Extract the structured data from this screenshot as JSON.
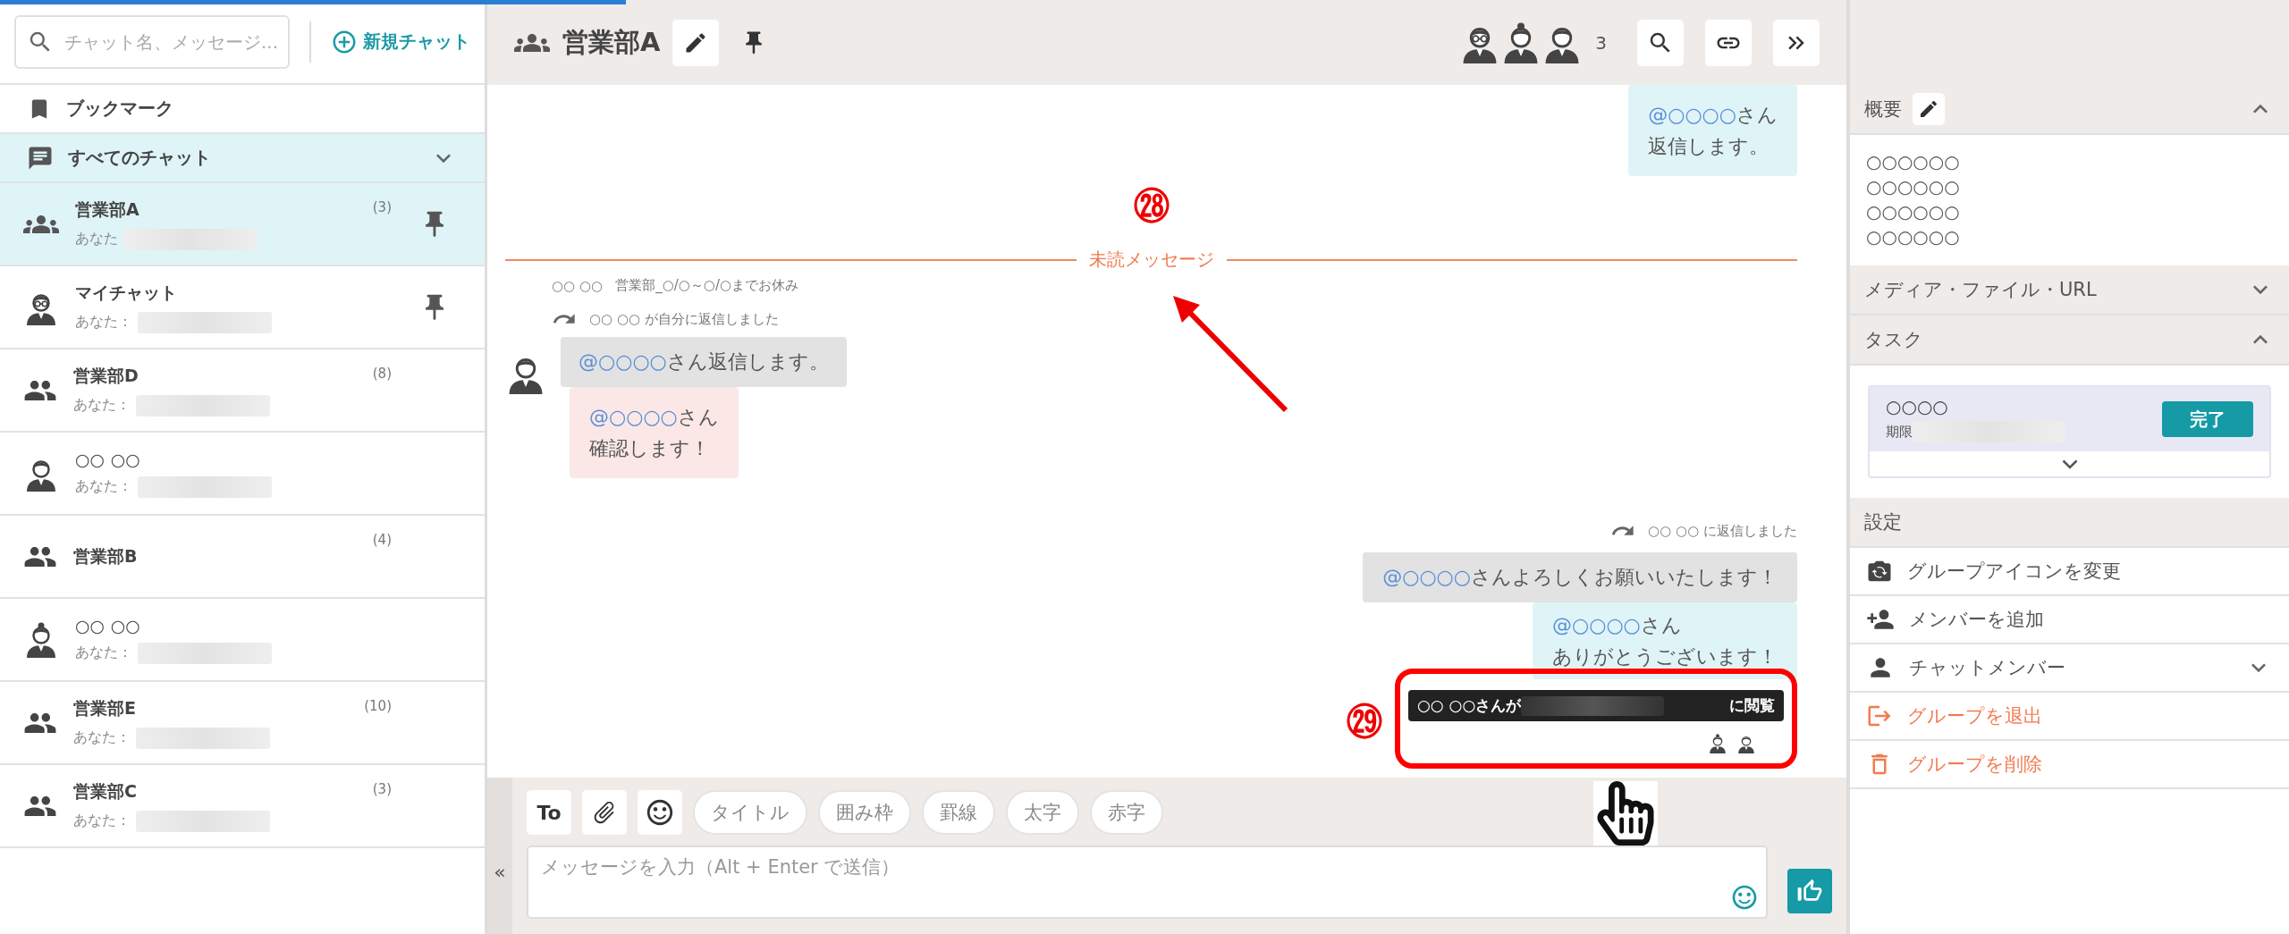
{
  "sidebar": {
    "search": {
      "placeholder": "チャット名、メッセージ..."
    },
    "new_chat": "新規チャット",
    "bookmark": "ブックマーク",
    "all_chats": {
      "label": "すべてのチャット",
      "expanded": true
    },
    "chats": [
      {
        "name": "営業部A",
        "preview": "あなた",
        "count": "(3)",
        "pinned": true,
        "selected": true,
        "kind": "groups"
      },
      {
        "name": "マイチャット",
        "preview": "あなた：",
        "pinned": true,
        "selected": false,
        "kind": "glasses"
      },
      {
        "name": "営業部D",
        "preview": "あなた：",
        "count": "(8)",
        "pinned": false,
        "selected": false,
        "kind": "group"
      },
      {
        "name": "○○ ○○",
        "preview": "あなた：",
        "pinned": false,
        "selected": false,
        "kind": "man"
      },
      {
        "name": "営業部B",
        "count": "(4)",
        "pinned": false,
        "selected": false,
        "kind": "group"
      },
      {
        "name": "○○ ○○",
        "preview": "あなた：",
        "pinned": false,
        "selected": false,
        "kind": "woman"
      },
      {
        "name": "営業部E",
        "preview": "あなた：",
        "count": "(10)",
        "pinned": false,
        "selected": false,
        "kind": "group"
      },
      {
        "name": "営業部C",
        "preview": "あなた：",
        "count": "(3)",
        "pinned": false,
        "selected": false,
        "kind": "group"
      }
    ]
  },
  "header": {
    "title": "営業部A",
    "member_count": "3"
  },
  "messages": [
    {
      "kind": "own",
      "lines": [
        {
          "mention": "@○○○○",
          "text": "さん"
        },
        {
          "text": "返信します。"
        }
      ]
    },
    {
      "kind": "divider",
      "label": "未読メッセージ",
      "marker": "㉘"
    },
    {
      "kind": "incoming",
      "sender": "○○ ○○",
      "status": "営業部_○/○～○/○までお休み",
      "reply_note": "○○ ○○ が自分に返信しました",
      "quote": {
        "mention": "@○○○○",
        "text": "さん返信します。"
      },
      "lines": [
        {
          "mention": "@○○○○",
          "text": "さん"
        },
        {
          "text": "確認します！"
        }
      ]
    },
    {
      "kind": "own",
      "reply_note": "○○ ○○ に返信しました",
      "quote": {
        "mention": "@○○○○",
        "text": "さんよろしくお願いいたします！"
      },
      "lines": [
        {
          "mention": "@○○○○",
          "text": "さん"
        },
        {
          "text": "ありがとうございます！"
        }
      ],
      "marker": "㉙",
      "tooltip": {
        "before": "○○ ○○さんが",
        "after": "に閲覧"
      },
      "readers": [
        {
          "kind": "woman"
        },
        {
          "kind": "man"
        }
      ]
    }
  ],
  "composer": {
    "collapse": "«",
    "to": "To",
    "formats": [
      "タイトル",
      "囲み枠",
      "罫線",
      "太字",
      "赤字"
    ],
    "placeholder": "メッセージを入力（Alt + Enter で送信）"
  },
  "panel": {
    "sections": [
      {
        "kind": "summary",
        "title": "概要",
        "expanded": true,
        "lines": [
          "○○○○○○",
          "○○○○○○",
          "○○○○○○",
          "○○○○○○"
        ]
      },
      {
        "kind": "plain",
        "title": "メディア・ファイル・URL",
        "expanded": false
      },
      {
        "kind": "tasks",
        "title": "タスク",
        "expanded": true,
        "tasks": [
          {
            "title": "○○○○",
            "due": "期限",
            "action": "完了"
          }
        ]
      },
      {
        "kind": "settings",
        "title": "設定",
        "items": [
          {
            "kind": "camera",
            "label": "グループアイコンを変更",
            "danger": false
          },
          {
            "kind": "add-person",
            "label": "メンバーを追加",
            "danger": false
          },
          {
            "kind": "person",
            "label": "チャットメンバー",
            "danger": false,
            "expanded": false
          },
          {
            "kind": "leave",
            "label": "グループを退出",
            "danger": true
          },
          {
            "kind": "delete",
            "label": "グループを削除",
            "danger": true
          }
        ]
      }
    ]
  }
}
